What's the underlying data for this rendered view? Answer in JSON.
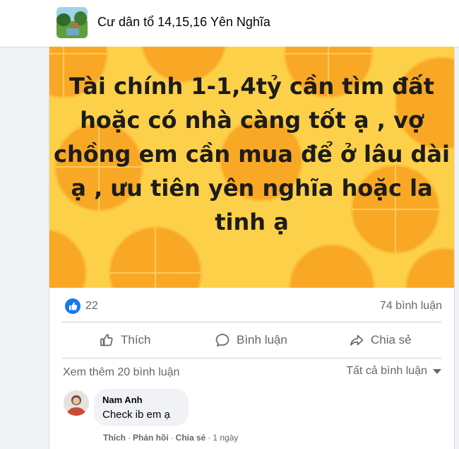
{
  "group": {
    "name": "Cư dân tổ 14,15,16 Yên Nghĩa"
  },
  "post": {
    "text_lines": [
      "Tài chính 1-1,4tỷ cần tìm đất",
      "hoặc có nhà càng tốt ạ , vợ",
      "chồng em cần mua để ở lâu dài",
      "ạ , ưu tiên yên nghĩa hoặc la",
      "tinh ạ"
    ],
    "background_color": "#fcca2c",
    "text_color": "#1c1c1c"
  },
  "stats": {
    "reaction_icon": "like-icon",
    "reaction_count": "22",
    "comment_count": "74 bình luận"
  },
  "actions": {
    "like_label": "Thích",
    "comment_label": "Bình luận",
    "share_label": "Chia sẻ"
  },
  "comments": {
    "view_more": "Xem thêm 20 bình luận",
    "filter_label": "Tất cả bình luận",
    "items": [
      {
        "author": "Nam Anh",
        "text": "Check ib em ạ",
        "like": "Thích",
        "reply": "Phản hồi",
        "share": "Chia sẻ",
        "time": "1 ngày"
      }
    ]
  },
  "colors": {
    "accent": "#1877f2",
    "secondary_text": "#65676b"
  }
}
